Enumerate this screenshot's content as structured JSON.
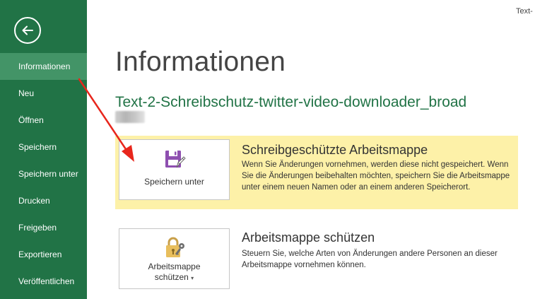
{
  "window": {
    "title_fragment": "Text-"
  },
  "sidebar": {
    "back_icon": "back-arrow-icon",
    "items": [
      {
        "label": "Informationen",
        "active": true
      },
      {
        "label": "Neu"
      },
      {
        "label": "Öffnen"
      },
      {
        "label": "Speichern"
      },
      {
        "label": "Speichern unter"
      },
      {
        "label": "Drucken"
      },
      {
        "label": "Freigeben"
      },
      {
        "label": "Exportieren"
      },
      {
        "label": "Veröffentlichen"
      }
    ]
  },
  "main": {
    "title": "Informationen",
    "document_name": "Text-2-Schreibschutz-twitter-video-downloader_broad",
    "sections": [
      {
        "button_label": "Speichern unter",
        "button_icon": "save-as-icon",
        "title": "Schreibgeschützte Arbeitsmappe",
        "description": "Wenn Sie Änderungen vornehmen, werden diese nicht gespeichert. Wenn Sie die Änderungen beibehalten möchten, speichern Sie die Arbeitsmappe unter einem neuen Namen oder an einem anderen Speicherort.",
        "highlight_color": "#fdf1a8"
      },
      {
        "button_label_line1": "Arbeitsmappe",
        "button_label_line2": "schützen",
        "button_icon": "lock-key-icon",
        "title": "Arbeitsmappe schützen",
        "description": "Steuern Sie, welche Arten von Änderungen andere Personen an dieser Arbeitsmappe vornehmen können."
      }
    ]
  },
  "colors": {
    "sidebar": "#217346",
    "sidebar_active": "#439467",
    "doc_name": "#217346",
    "annotation_arrow": "#e8261c"
  }
}
